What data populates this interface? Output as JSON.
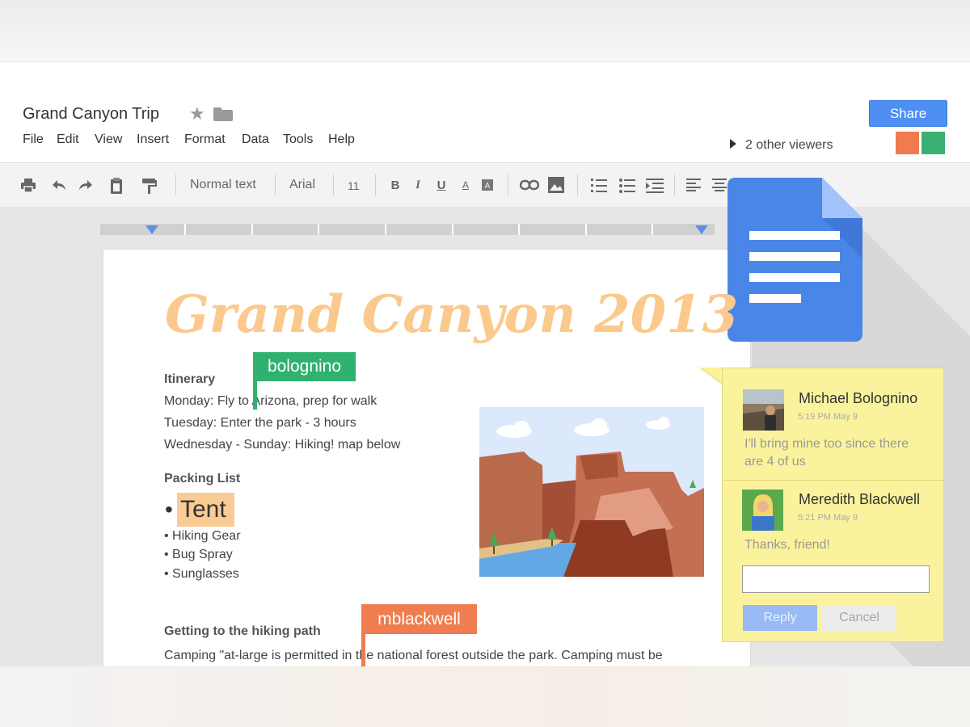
{
  "header": {
    "title": "Grand Canyon Trip",
    "menu": [
      "File",
      "Edit",
      "View",
      "Insert",
      "Format",
      "Data",
      "Tools",
      "Help"
    ],
    "share_label": "Share",
    "viewers_text": "2 other viewers"
  },
  "toolbar": {
    "style_label": "Normal text",
    "font_label": "Arial",
    "size_label": "11",
    "bold": "B",
    "italic": "I",
    "underline": "U",
    "text_color": "A"
  },
  "document": {
    "heading": "Grand Canyon 2013",
    "itinerary_heading": "Itinerary",
    "itinerary": [
      "Monday: Fly to Arizona, prep for walk",
      "Tuesday: Enter the park - 3 hours",
      "Wednesday - Sunday: Hiking!  map below"
    ],
    "packing_heading": "Packing List",
    "packing_first": "Tent",
    "packing_bullet": "•",
    "packing_items": [
      "• Hiking Gear",
      "• Bug Spray",
      "• Sunglasses"
    ],
    "hiking_heading": "Getting to the hiking path",
    "hiking_text": "Camping \"at-large is permitted in the national forest outside the park. Camping must be"
  },
  "cursors": [
    {
      "user": "bolognino",
      "color": "#2fb170"
    },
    {
      "user": "mblackwell",
      "color": "#f07d4f"
    }
  ],
  "comments": [
    {
      "author": "Michael Bolognino",
      "time": "5:19 PM May 9",
      "text": "I'll bring mine too since there are 4 of us"
    },
    {
      "author": "Meredith Blackwell",
      "time": "5:21 PM May 9",
      "text": "Thanks, friend!"
    }
  ],
  "comment_actions": {
    "reply": "Reply",
    "cancel": "Cancel"
  },
  "colors": {
    "share_blue": "#4d8ff3",
    "heading_orange": "#fbc98c",
    "comment_yellow": "#fbf29d",
    "docs_blue": "#4a86e8"
  }
}
